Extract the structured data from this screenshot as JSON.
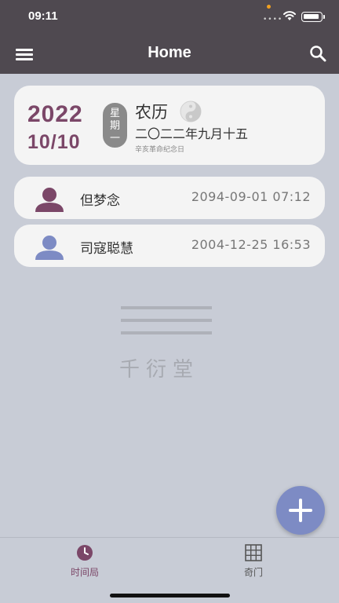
{
  "status_bar": {
    "time": "09:11",
    "signal": "••••"
  },
  "app_bar": {
    "title": "Home",
    "menu_icon": "menu-icon",
    "search_icon": "search-icon"
  },
  "date_card": {
    "year": "2022",
    "month_day": "10/10",
    "weekday_line1": "星",
    "weekday_line2": "期",
    "weekday_line3": "一",
    "lunar_label": "农历",
    "lunar_icon": "yin-yang-icon",
    "lunar_date": "二〇二二年九月十五",
    "holiday": "辛亥革命纪念日"
  },
  "people": [
    {
      "name": "但梦念",
      "datetime": "2094-09-01 07:12",
      "avatar_color": "#7b4768"
    },
    {
      "name": "司寇聪慧",
      "datetime": "2004-12-25 16:53",
      "avatar_color": "#7d8bc4"
    }
  ],
  "watermark": {
    "text": "千衍堂"
  },
  "fab": {
    "icon": "plus-icon",
    "color": "#7d8bc4"
  },
  "bottom_nav": {
    "tabs": [
      {
        "label": "时间局",
        "icon": "clock-icon",
        "active": true
      },
      {
        "label": "奇门",
        "icon": "grid-icon",
        "active": false
      }
    ]
  },
  "colors": {
    "accent": "#7b4768",
    "header": "#4f4950",
    "background": "#c8ccd6",
    "fab": "#7d8bc4"
  }
}
